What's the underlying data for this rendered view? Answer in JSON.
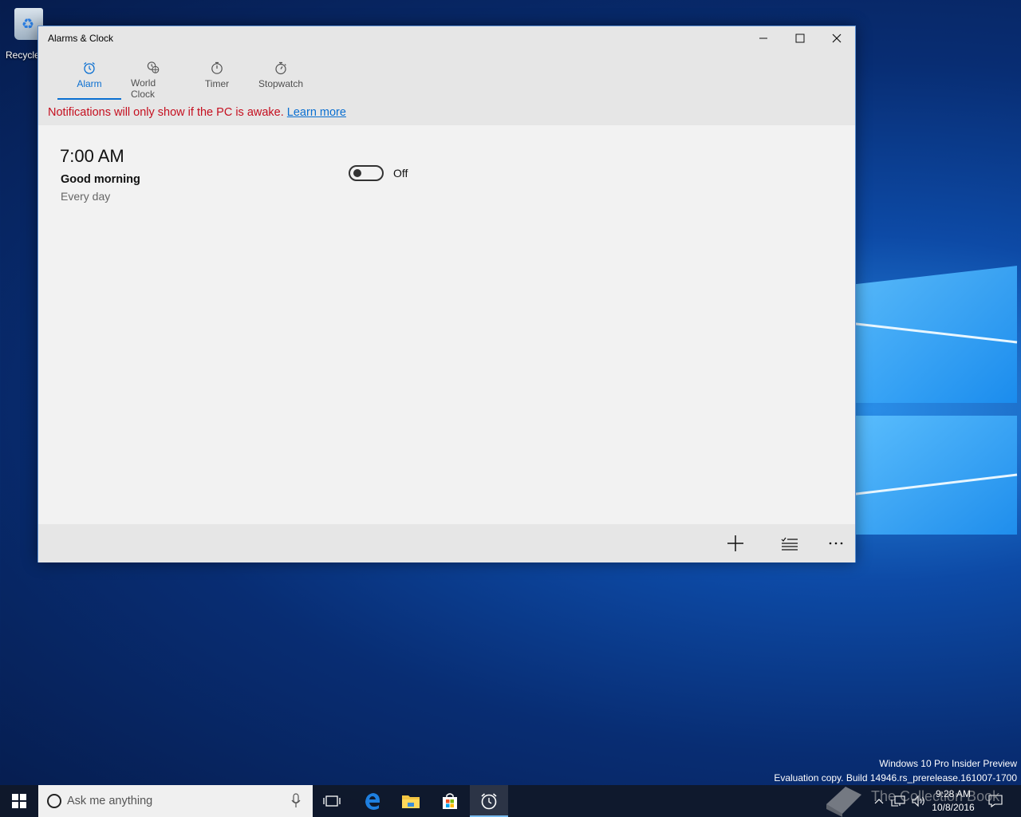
{
  "desktop": {
    "recycle_bin_label": "Recycle",
    "watermark_line1": "Windows 10 Pro Insider Preview",
    "watermark_line2": "Evaluation copy. Build 14946.rs_prerelease.161007-1700"
  },
  "window": {
    "title": "Alarms & Clock",
    "accent_color": "#0a6fd1",
    "warning_color": "#c50f1f"
  },
  "tabs": [
    {
      "label": "Alarm",
      "icon": "alarm-clock-icon",
      "active": true
    },
    {
      "label": "World Clock",
      "icon": "world-clock-icon",
      "active": false
    },
    {
      "label": "Timer",
      "icon": "timer-icon",
      "active": false
    },
    {
      "label": "Stopwatch",
      "icon": "stopwatch-icon",
      "active": false
    }
  ],
  "notice": {
    "text": "Notifications will only show if the PC is awake.",
    "link": "Learn more"
  },
  "alarms": [
    {
      "time": "7:00 AM",
      "name": "Good morning",
      "repeat": "Every day",
      "state": "Off",
      "enabled": false
    }
  ],
  "commandbar": {
    "add": "plus-icon",
    "select": "select-list-icon",
    "more": "more-ellipsis-icon"
  },
  "taskbar": {
    "search_placeholder": "Ask me anything",
    "clock_time": "9:28 AM",
    "clock_date": "10/8/2016",
    "collection_text": "The Collection Book"
  }
}
